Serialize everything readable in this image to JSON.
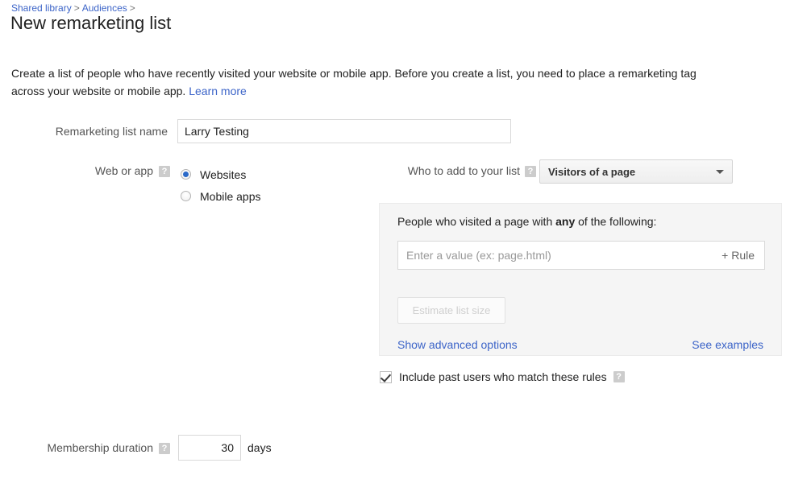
{
  "breadcrumb": {
    "items": [
      {
        "label": "Shared library"
      },
      {
        "label": "Audiences"
      }
    ],
    "separator": ">"
  },
  "page_title": "New remarketing list",
  "description": {
    "text": "Create a list of people who have recently visited your website or mobile app. Before you create a list, you need to place a remarketing tag across your website or mobile app.",
    "link_label": "Learn more"
  },
  "help_icon_glyph": "?",
  "form": {
    "list_name": {
      "label": "Remarketing list name",
      "value": "Larry Testing",
      "placeholder": ""
    },
    "web_or_app": {
      "label": "Web or app",
      "options": [
        {
          "label": "Websites",
          "selected": true
        },
        {
          "label": "Mobile apps",
          "selected": false
        }
      ]
    },
    "who_to_add": {
      "label": "Who to add to your list",
      "selected_value": "Visitors of a page",
      "icon": "chevron-down-icon"
    },
    "rules": {
      "heading_prefix": "People who visited a page with ",
      "heading_bold": "any",
      "heading_suffix": " of the following:",
      "rule_input_placeholder": "Enter a value (ex: page.html)",
      "rule_input_value": "",
      "add_rule_label": "+ Rule",
      "estimate_button_label": "Estimate list size",
      "estimate_button_disabled": true,
      "advanced_options_link": "Show advanced options",
      "see_examples_link": "See examples"
    },
    "include_past_users": {
      "label": "Include past users who match these rules",
      "checked": true
    },
    "membership_duration": {
      "label": "Membership duration",
      "value": "30",
      "unit": "days"
    }
  },
  "colors": {
    "link": "#3c64c8",
    "radio_selected": "#2a69c8",
    "panel_bg": "#f5f5f5",
    "help_icon_bg": "#cccccc"
  }
}
